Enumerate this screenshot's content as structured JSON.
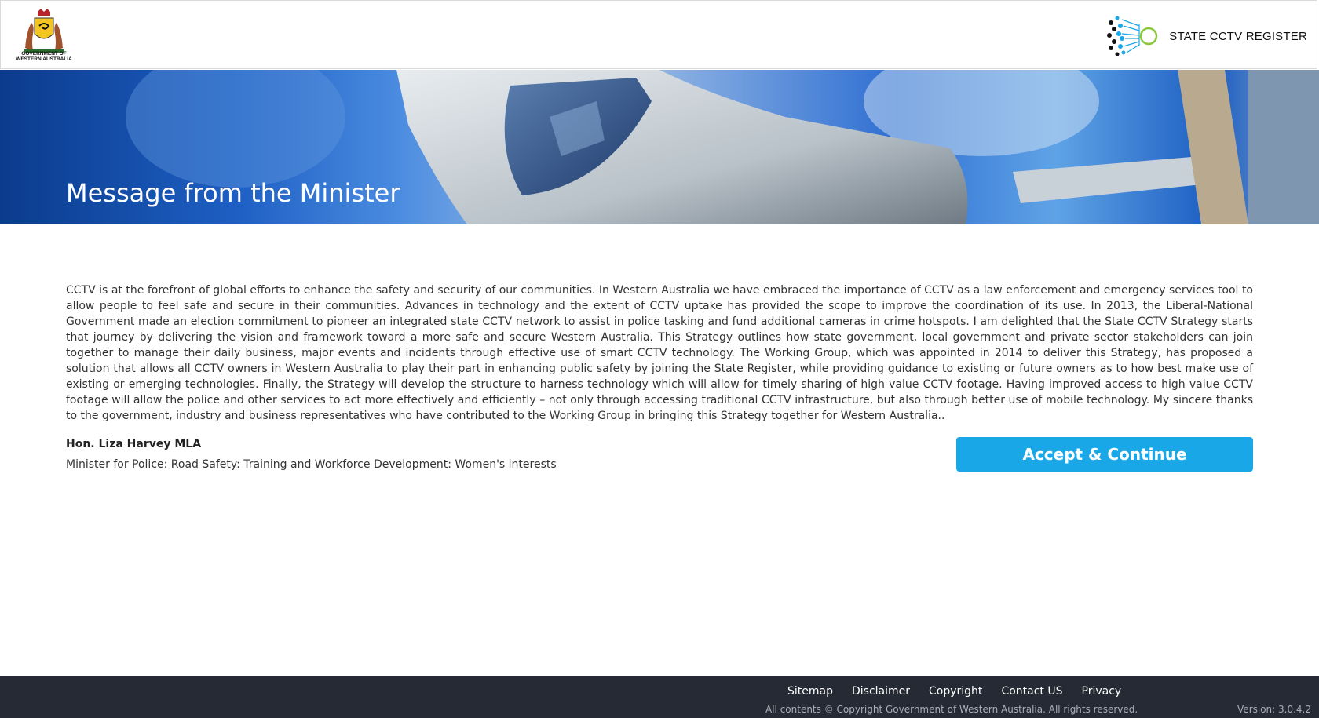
{
  "header": {
    "gov_logo_text": "GOVERNMENT OF WESTERN AUSTRALIA",
    "brand_name": "STATE CCTV REGISTER",
    "brand_colors": [
      "#1aa7e8",
      "#8cc63f",
      "#1a1a1a"
    ]
  },
  "hero": {
    "title": "Message from the Minister",
    "image_icon": "cctv-camera-photo"
  },
  "main": {
    "message": "CCTV is at the forefront of global efforts to enhance the safety and security of our communities. In Western Australia we have embraced the importance of CCTV as a law enforcement and emergency services tool to allow people to feel safe and secure in their communities. Advances in technology and the extent of CCTV uptake has provided the scope to improve the coordination of its use. In 2013, the Liberal-National Government made an election commitment to pioneer an integrated state CCTV network to assist in police tasking and fund additional cameras in crime hotspots.  I am delighted that the State CCTV Strategy starts that journey by delivering the vision and framework toward a more safe and secure Western Australia. This Strategy outlines how state government, local government and private sector stakeholders can join together to manage their daily business, major events and incidents through effective use of smart CCTV technology.  The Working Group, which was appointed in 2014 to deliver this Strategy, has proposed a solution that allows all CCTV owners in Western Australia to play their part in enhancing public safety by joining the State Register, while providing guidance to existing or future owners as to how best make use of existing or emerging technologies.  Finally, the Strategy will develop the structure to harness technology which will allow for timely sharing of high value CCTV footage. Having improved access to high value CCTV footage will allow the police and other services to act more effectively and efficiently – not only through accessing traditional CCTV infrastructure, but also through better use of mobile technology.  My sincere thanks to the government, industry and business representatives who have contributed to the Working Group in bringing this Strategy together for Western Australia..",
    "signature_name": "Hon. Liza Harvey MLA",
    "signature_title": "Minister for Police: Road Safety: Training and Workforce Development: Women's interests",
    "accept_label": "Accept & Continue",
    "accent_color": "#1aa7e8"
  },
  "footer": {
    "links": [
      "Sitemap",
      "Disclaimer",
      "Copyright",
      "Contact US",
      "Privacy"
    ],
    "copyright": "All contents © Copyright Government of Western Australia. All rights reserved.",
    "version": "Version: 3.0.4.2",
    "background": "#252a34"
  }
}
